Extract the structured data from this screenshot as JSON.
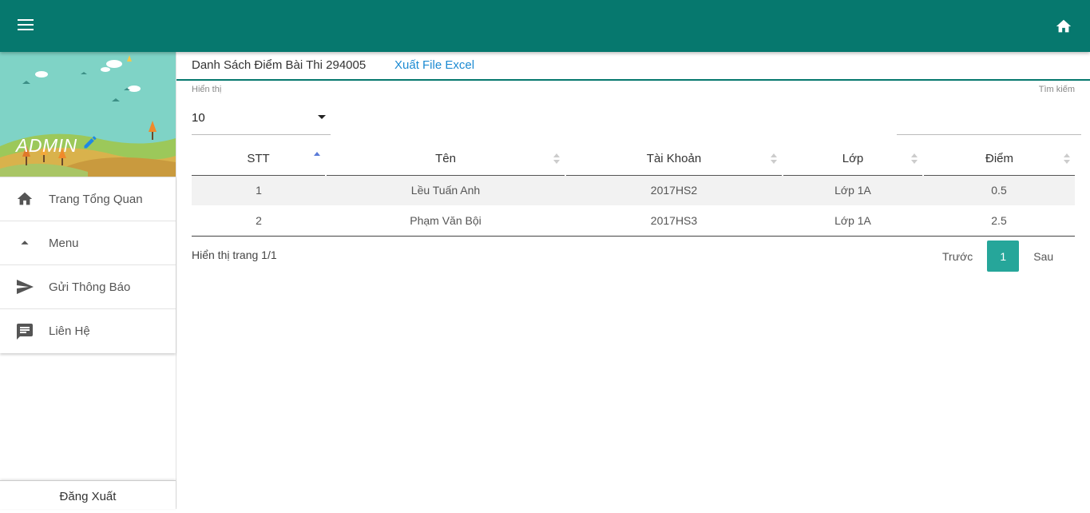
{
  "header": {
    "menu_icon": "menu-icon",
    "home_icon": "home-icon",
    "color": "#06786e"
  },
  "sidebar": {
    "user_name": "ADMIN",
    "items": [
      {
        "label": "Trang Tổng Quan",
        "icon": "home-icon"
      },
      {
        "label": "Menu",
        "icon": "arrow-up-icon"
      },
      {
        "label": "Gửi Thông Báo",
        "icon": "send-icon"
      },
      {
        "label": "Liên Hệ",
        "icon": "chat-icon"
      }
    ],
    "logout_label": "Đăng Xuất"
  },
  "main": {
    "title": "Danh Sách Điểm Bài Thi 294005",
    "export_label": "Xuất File Excel",
    "show_label": "Hiển thị",
    "page_size": "10",
    "search_label": "Tìm kiếm",
    "columns": [
      "STT",
      "Tên",
      "Tài Khoản",
      "Lớp",
      "Điểm"
    ],
    "rows": [
      [
        "1",
        "Lều Tuấn Anh",
        "2017HS2",
        "Lớp 1A",
        "0.5"
      ],
      [
        "2",
        "Phạm Văn Bội",
        "2017HS3",
        "Lớp 1A",
        "2.5"
      ]
    ],
    "page_info": "Hiển thị trang 1/1",
    "pagination": {
      "prev": "Trước",
      "current": "1",
      "next": "Sau"
    }
  }
}
